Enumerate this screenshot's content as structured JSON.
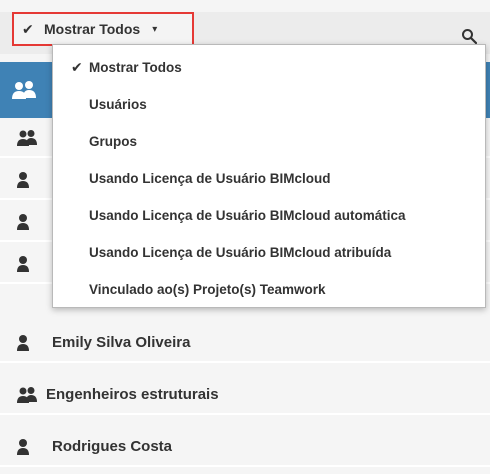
{
  "filter": {
    "selected_label": "Mostrar Todos",
    "check_glyph": "✔",
    "caret_glyph": "▾"
  },
  "dropdown": {
    "items": [
      {
        "label": "Mostrar Todos",
        "checked": true
      },
      {
        "label": "Usuários",
        "checked": false
      },
      {
        "label": "Grupos",
        "checked": false
      },
      {
        "label": "Usando Licença de Usuário BIMcloud",
        "checked": false
      },
      {
        "label": "Usando Licença de Usuário BIMcloud automática",
        "checked": false
      },
      {
        "label": "Usando Licença de Usuário BIMcloud atribuída",
        "checked": false
      },
      {
        "label": "Vinculado ao(s) Projeto(s) Teamwork",
        "checked": false
      }
    ]
  },
  "list": {
    "rows": [
      {
        "type": "group",
        "label": "",
        "icon": "group-icon"
      },
      {
        "type": "user",
        "label": "",
        "icon": "user-icon"
      },
      {
        "type": "user",
        "label": "",
        "icon": "user-icon"
      },
      {
        "type": "user",
        "label": "",
        "icon": "user-icon"
      },
      {
        "type": "user",
        "label": "Emily Silva Oliveira",
        "icon": "user-icon"
      },
      {
        "type": "group",
        "label": "Engenheiros estruturais",
        "icon": "group-icon"
      },
      {
        "type": "user",
        "label": "Rodrigues Costa",
        "icon": "user-icon"
      }
    ]
  },
  "colors": {
    "header_blue": "#3f82b5",
    "highlight_red": "#e53935",
    "text_dark": "#333333"
  }
}
